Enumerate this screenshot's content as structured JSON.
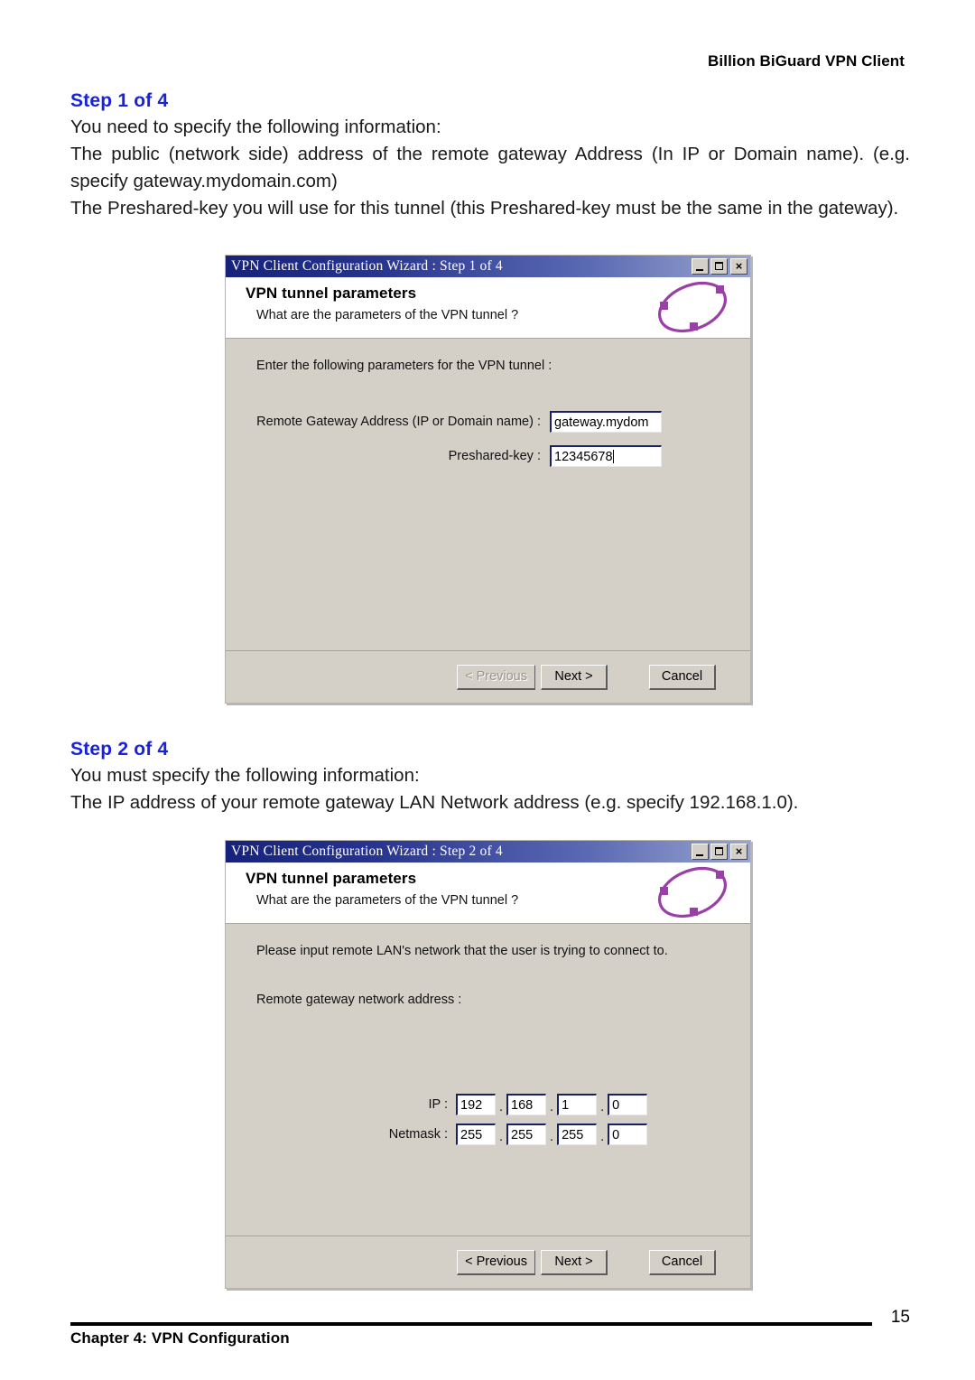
{
  "header": {
    "title": "Billion BiGuard VPN Client"
  },
  "sections": [
    {
      "heading": "Step 1 of 4",
      "paragraphs": [
        "You need to specify the following information:",
        "The public (network side) address of the remote gateway Address (In IP or Domain name). (e.g. specify gateway.mydomain.com)",
        "The Preshared-key you will use for this tunnel (this Preshared-key must be the same in the gateway)."
      ]
    },
    {
      "heading": "Step 2 of 4",
      "paragraphs": [
        "You must specify the following information:",
        "The IP address of your remote gateway LAN Network address (e.g. specify 192.168.1.0)."
      ]
    }
  ],
  "dialog1": {
    "titlebar": "VPN Client Configuration Wizard : Step 1 of 4",
    "window_controls": {
      "minimize": "minimize-icon",
      "maximize": "maximize-icon",
      "close": "×"
    },
    "header_title": "VPN tunnel parameters",
    "header_subtitle": "What are the parameters of the VPN tunnel ?",
    "icon": "vpn-ring-icon",
    "intro": "Enter the following parameters for the VPN tunnel :",
    "fields": [
      {
        "label": "Remote Gateway Address (IP or Domain name) :",
        "value": "gateway.mydom"
      },
      {
        "label": "Preshared-key :",
        "value": "12345678"
      }
    ],
    "buttons": {
      "previous": "< Previous",
      "next": "Next >",
      "cancel": "Cancel",
      "previous_enabled": false
    }
  },
  "dialog2": {
    "titlebar": "VPN Client Configuration Wizard : Step 2 of 4",
    "window_controls": {
      "minimize": "minimize-icon",
      "maximize": "maximize-icon",
      "close": "×"
    },
    "header_title": "VPN tunnel parameters",
    "header_subtitle": "What are the parameters of the VPN tunnel ?",
    "icon": "vpn-ring-icon",
    "intro": "Please input remote LAN's network that the user is trying to connect to.",
    "section_label": "Remote gateway network address :",
    "ip": {
      "label": "IP :",
      "octets": [
        "192",
        "168",
        "1",
        "0"
      ],
      "separator": "."
    },
    "netmask": {
      "label": "Netmask :",
      "octets": [
        "255",
        "255",
        "255",
        "0"
      ],
      "separator": "."
    },
    "buttons": {
      "previous": "< Previous",
      "next": "Next >",
      "cancel": "Cancel",
      "previous_enabled": true
    }
  },
  "footer": {
    "chapter": "Chapter 4: VPN Configuration",
    "page_number": "15"
  },
  "colors": {
    "heading_blue": "#1822dd",
    "titlebar_blue": "#16227a",
    "dialog_face": "#d4d0c8",
    "ring_purple": "#9b3fa8"
  }
}
